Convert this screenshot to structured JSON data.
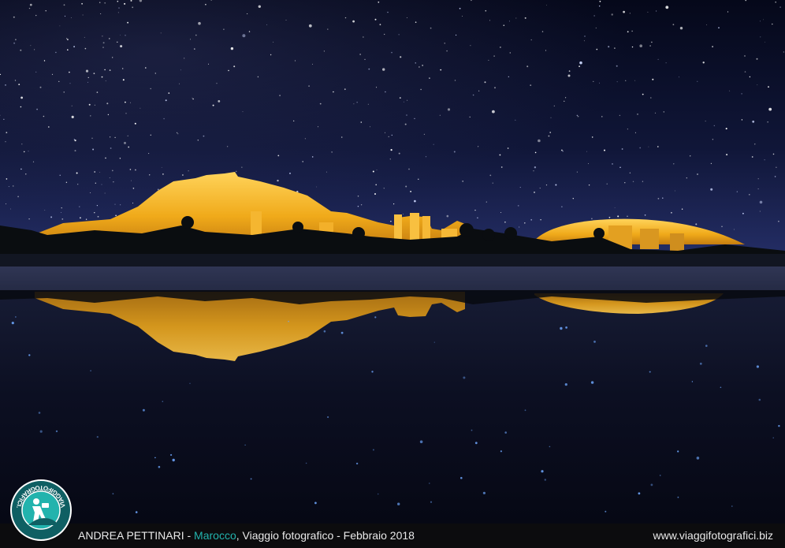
{
  "caption": {
    "author": "ANDREA PETTINARI",
    "separator": " - ",
    "place": "Marocco",
    "trip": ", Viaggio fotografico - Febbraio 2018",
    "website": "www.viaggifotografici.biz"
  },
  "logo": {
    "ring_text": "VIAGGIFOTOGRAFICI.BIZ",
    "icon": "photographer-icon"
  },
  "colors": {
    "accent": "#22b3ad",
    "sky_top": "#070a1c",
    "sky_horizon": "#232c63",
    "illuminated_rock": "#f2b21d",
    "caption_bar": "#0c0c0e"
  }
}
